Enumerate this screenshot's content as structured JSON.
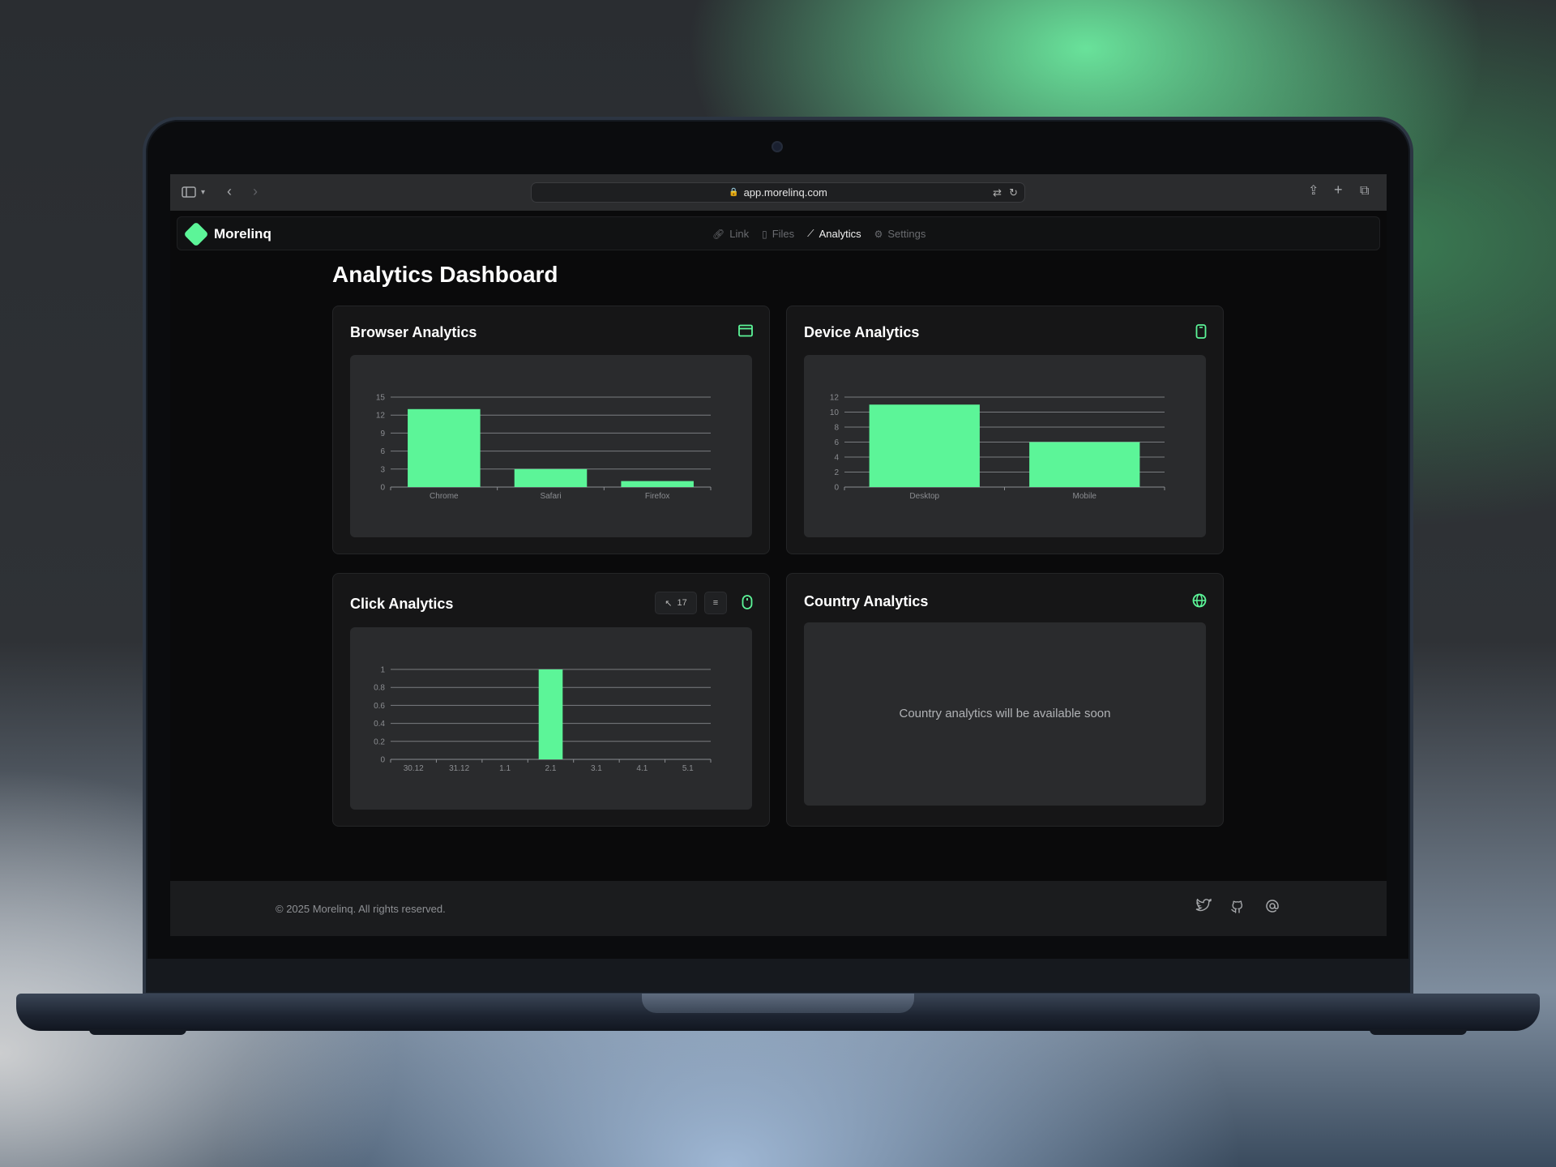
{
  "browser": {
    "url": "app.morelinq.com",
    "icons": [
      "sidebar-icon",
      "chevron-down-icon",
      "back-icon",
      "forward-icon",
      "translate-icon",
      "reload-icon",
      "share-icon",
      "plus-icon",
      "tabs-icon"
    ]
  },
  "app": {
    "brand": "Morelinq",
    "nav": [
      {
        "label": "Link",
        "icon": "link-icon",
        "active": false
      },
      {
        "label": "Files",
        "icon": "file-icon",
        "active": false
      },
      {
        "label": "Analytics",
        "icon": "chart-icon",
        "active": true
      },
      {
        "label": "Settings",
        "icon": "gear-icon",
        "active": false
      }
    ],
    "accent": "#5cf598"
  },
  "page": {
    "title": "Analytics Dashboard"
  },
  "cards": {
    "browser": {
      "title": "Browser Analytics",
      "icon": "browser-window-icon"
    },
    "device": {
      "title": "Device Analytics",
      "icon": "phone-icon"
    },
    "click": {
      "title": "Click Analytics",
      "icon": "mouse-icon",
      "click_count": "17",
      "filter_icon": "filter-icon"
    },
    "country": {
      "title": "Country Analytics",
      "icon": "globe-icon",
      "message": "Country analytics will be available soon"
    }
  },
  "chart_data": [
    {
      "type": "bar",
      "categories": [
        "Chrome",
        "Safari",
        "Firefox"
      ],
      "values": [
        13,
        3,
        1
      ],
      "yticks": [
        "0",
        "3",
        "6",
        "9",
        "12",
        "15"
      ],
      "ylim": [
        0,
        15
      ],
      "grid": true,
      "color": "#5cf598"
    },
    {
      "type": "bar",
      "categories": [
        "Desktop",
        "Mobile"
      ],
      "values": [
        11,
        6
      ],
      "yticks": [
        "0",
        "2",
        "4",
        "6",
        "8",
        "10",
        "12"
      ],
      "ylim": [
        0,
        12
      ],
      "grid": true,
      "color": "#5cf598"
    },
    {
      "type": "bar",
      "categories": [
        "30.12",
        "31.12",
        "1.1",
        "2.1",
        "3.1",
        "4.1",
        "5.1"
      ],
      "values": [
        0,
        0,
        0,
        1,
        0,
        0,
        0
      ],
      "yticks": [
        "0",
        "0.2",
        "0.4",
        "0.6",
        "0.8",
        "1"
      ],
      "ylim": [
        0,
        1
      ],
      "grid": true,
      "color": "#5cf598"
    }
  ],
  "footer": {
    "copyright": "© 2025 Morelinq. All rights reserved.",
    "social": [
      "twitter-icon",
      "github-icon",
      "at-icon"
    ]
  }
}
